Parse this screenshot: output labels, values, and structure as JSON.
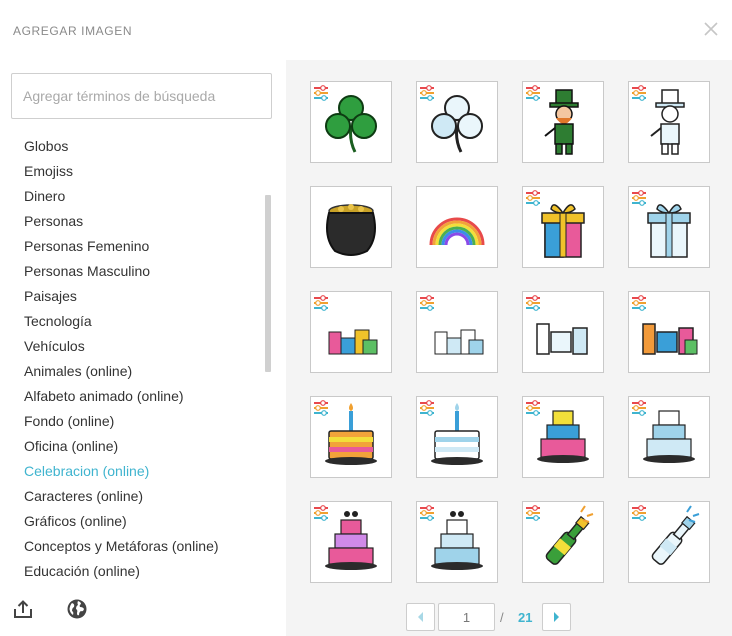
{
  "dialog": {
    "title": "AGREGAR IMAGEN",
    "close_icon": "close-icon"
  },
  "search": {
    "placeholder": "Agregar términos de búsqueda",
    "value": ""
  },
  "categories": [
    {
      "label": "Globos",
      "active": false
    },
    {
      "label": "Emojiss",
      "active": false
    },
    {
      "label": "Dinero",
      "active": false
    },
    {
      "label": "Personas",
      "active": false
    },
    {
      "label": "Personas Femenino",
      "active": false
    },
    {
      "label": "Personas Masculino",
      "active": false
    },
    {
      "label": "Paisajes",
      "active": false
    },
    {
      "label": "Tecnología",
      "active": false
    },
    {
      "label": "Vehículos",
      "active": false
    },
    {
      "label": "Animales (online)",
      "active": false
    },
    {
      "label": "Alfabeto animado (online)",
      "active": false
    },
    {
      "label": "Fondo (online)",
      "active": false
    },
    {
      "label": "Oficina (online)",
      "active": false
    },
    {
      "label": "Celebracion (online)",
      "active": true
    },
    {
      "label": "Caracteres (online)",
      "active": false
    },
    {
      "label": "Gráficos (online)",
      "active": false
    },
    {
      "label": "Conceptos y Metáforas (online)",
      "active": false
    },
    {
      "label": "Educación (online)",
      "active": false
    }
  ],
  "footer_icons": [
    "upload-icon",
    "globe-icon"
  ],
  "images": [
    {
      "name": "shamrock-green",
      "editable": true
    },
    {
      "name": "shamrock-blue",
      "editable": true
    },
    {
      "name": "leprechaun-green",
      "editable": true
    },
    {
      "name": "leprechaun-blue",
      "editable": true
    },
    {
      "name": "pot-of-gold",
      "editable": false
    },
    {
      "name": "rainbow",
      "editable": false
    },
    {
      "name": "gift-box-color",
      "editable": true
    },
    {
      "name": "gift-box-blue",
      "editable": true
    },
    {
      "name": "gift-group-color",
      "editable": true
    },
    {
      "name": "gift-group-blue",
      "editable": true
    },
    {
      "name": "card-group-blue",
      "editable": true
    },
    {
      "name": "card-group-color",
      "editable": true
    },
    {
      "name": "birthday-cake-color",
      "editable": true
    },
    {
      "name": "birthday-cake-blue",
      "editable": true
    },
    {
      "name": "tiered-cake-color",
      "editable": true
    },
    {
      "name": "tiered-cake-blue",
      "editable": true
    },
    {
      "name": "wedding-cake-pink",
      "editable": true
    },
    {
      "name": "wedding-cake-blue",
      "editable": true
    },
    {
      "name": "champagne-green",
      "editable": true
    },
    {
      "name": "champagne-blue",
      "editable": true
    }
  ],
  "pagination": {
    "current_page": "1",
    "separator": "/",
    "total_pages": "21"
  },
  "colors": {
    "accent": "#3fb4cf",
    "panel_bg": "#f4f4f4",
    "badge_red": "#e8494d",
    "badge_orange": "#f0a030",
    "badge_teal": "#3fb4cf"
  }
}
